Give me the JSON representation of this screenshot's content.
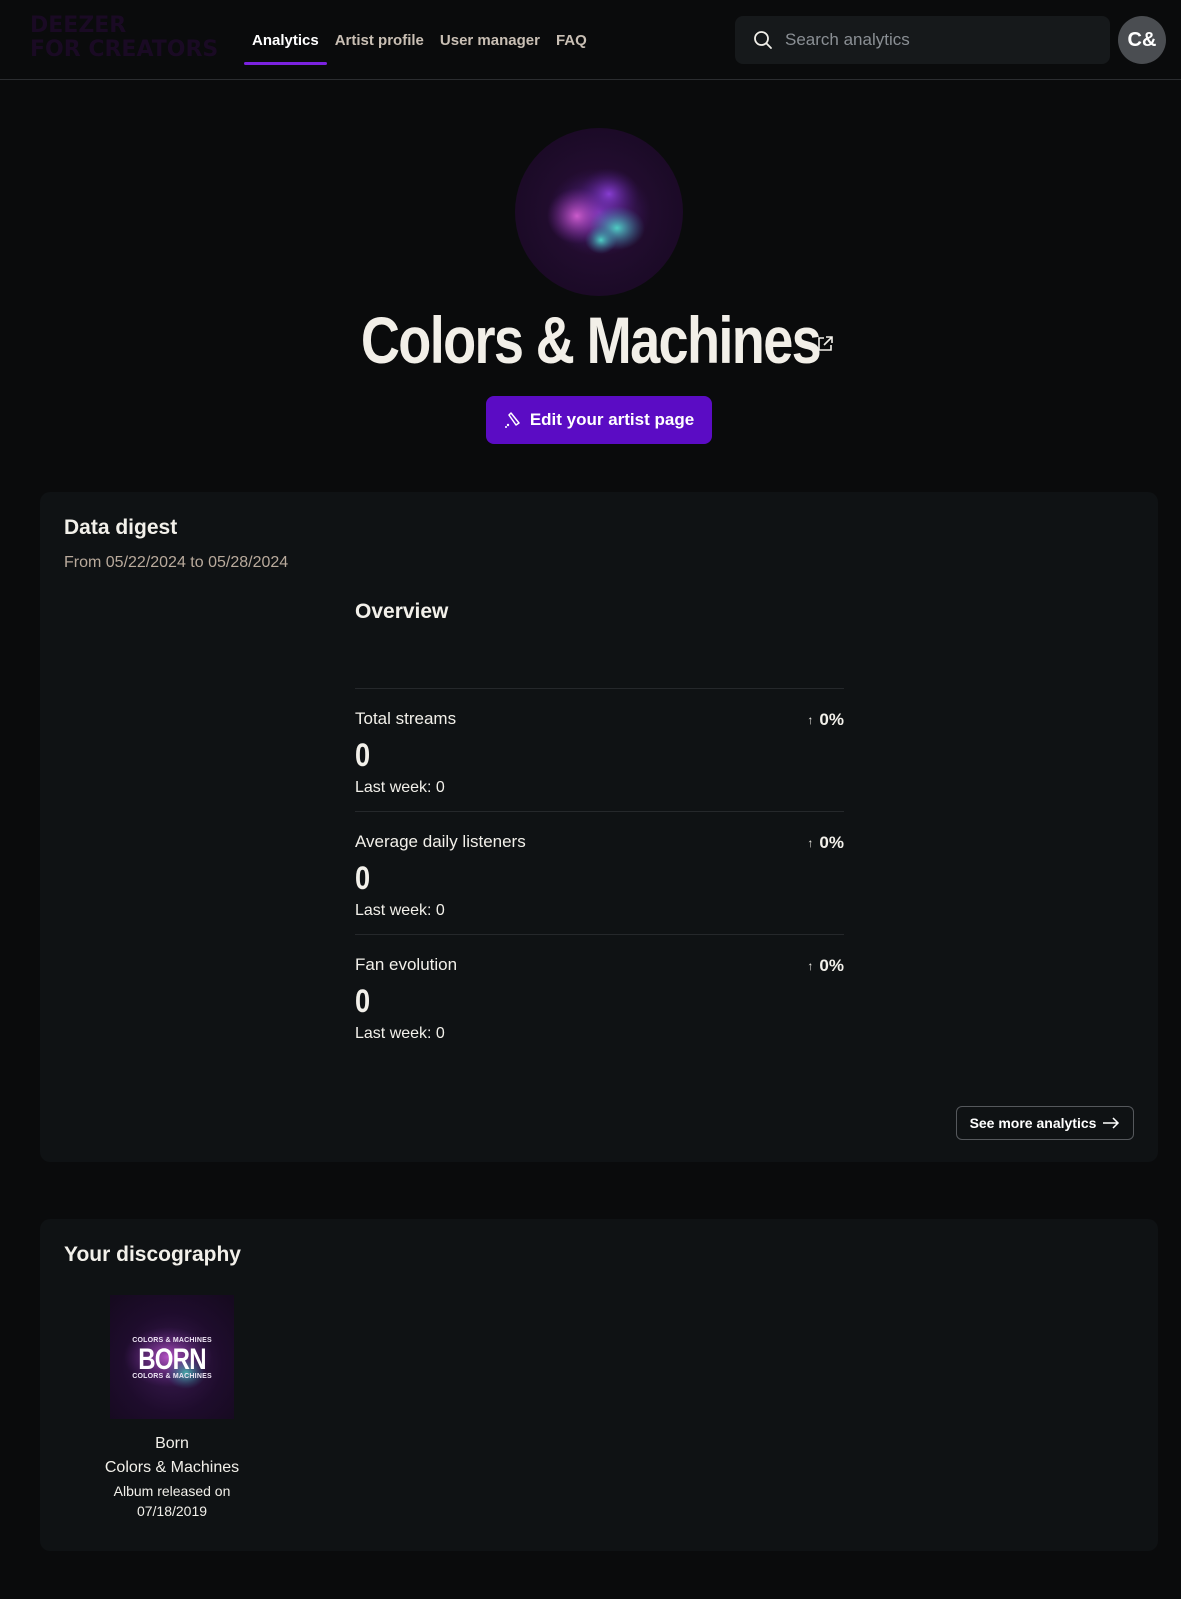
{
  "header": {
    "logo_line1": "DEEZER",
    "logo_line2": "FOR CREATORS",
    "nav": [
      {
        "label": "Analytics",
        "active": true
      },
      {
        "label": "Artist profile"
      },
      {
        "label": "User manager"
      },
      {
        "label": "FAQ"
      }
    ],
    "search_placeholder": "Search analytics",
    "avatar_initials": "C&"
  },
  "artist": {
    "name": "Colors & Machines",
    "edit_label": "Edit your artist page"
  },
  "digest": {
    "title": "Data digest",
    "range": "From 05/22/2024 to 05/28/2024",
    "overview_title": "Overview",
    "metrics": [
      {
        "label": "Total streams",
        "change": "0%",
        "value": "0",
        "last": "Last week: 0"
      },
      {
        "label": "Average daily listeners",
        "change": "0%",
        "value": "0",
        "last": "Last week: 0"
      },
      {
        "label": "Fan evolution",
        "change": "0%",
        "value": "0",
        "last": "Last week: 0"
      }
    ],
    "more_label": "See more analytics"
  },
  "discography": {
    "title": "Your discography",
    "albums": [
      {
        "cover_top": "COLORS & MACHINES",
        "cover_main": "BORN",
        "cover_bottom": "COLORS & MACHINES",
        "title": "Born",
        "artist": "Colors & Machines",
        "released_line1": "Album released on",
        "released_line2": "07/18/2019"
      }
    ]
  },
  "colors": {
    "accent": "#5b0cc4",
    "nav_underline": "#7b22e0",
    "background": "#0a0b0c",
    "card": "#0f1214"
  }
}
